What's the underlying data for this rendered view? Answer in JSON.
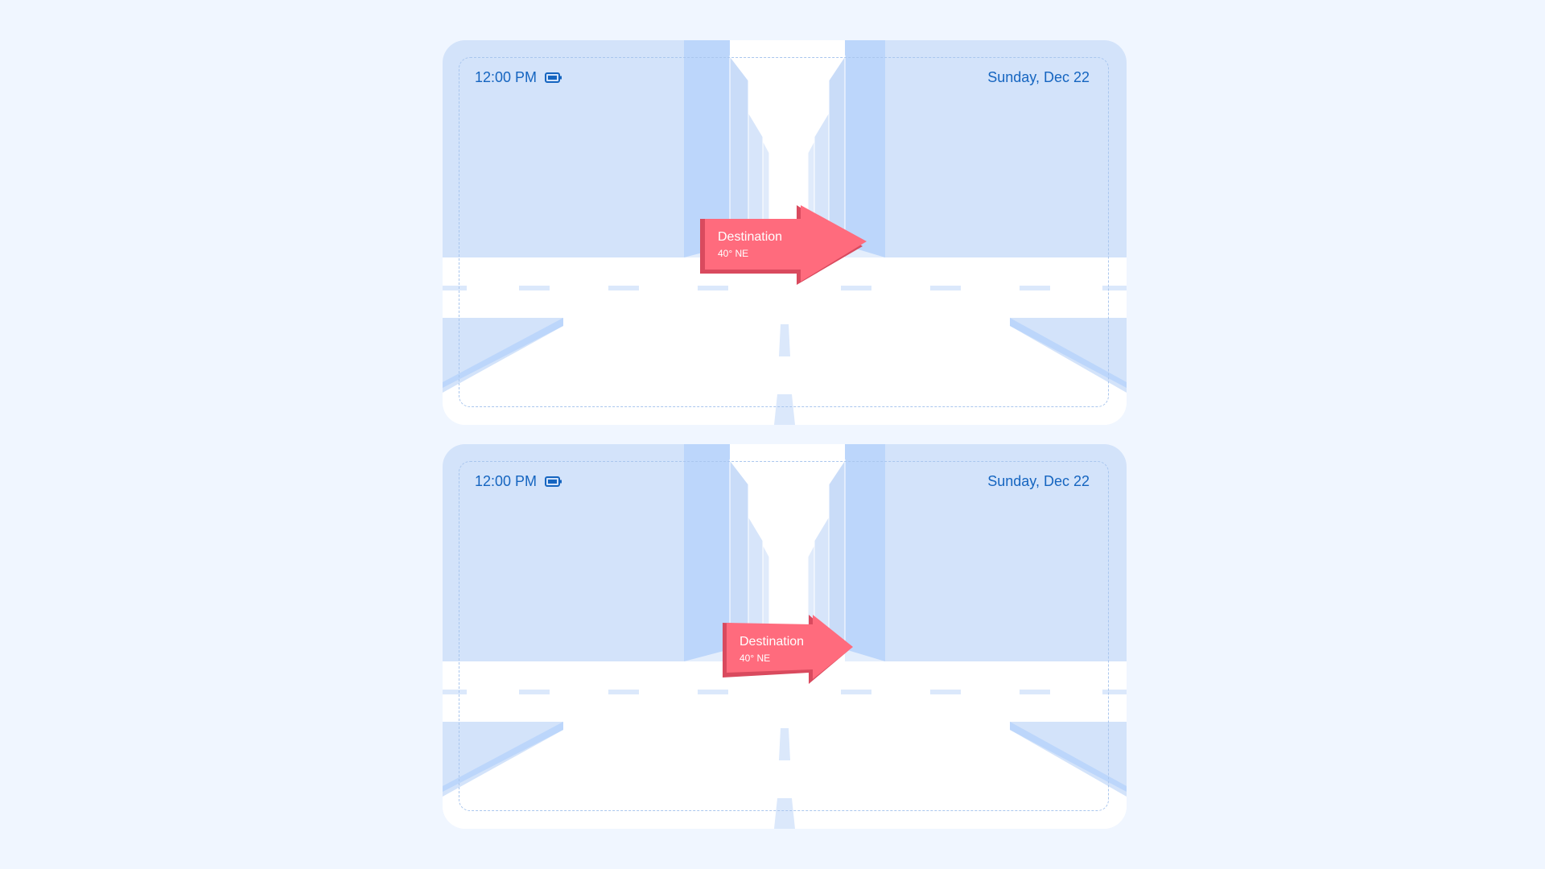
{
  "colors": {
    "background": "#f0f6ff",
    "accent": "#1565c0",
    "building_light": "#d3e3fa",
    "building_mid": "#bcd6fb",
    "sign": "#ff6b7d",
    "sign_dark": "#d94a5e"
  },
  "panels": [
    {
      "time": "12:00 PM",
      "battery_icon": "battery-icon",
      "date": "Sunday, Dec 22",
      "sign": {
        "title": "Destination",
        "subtitle": "40° NE",
        "style": "flat-arrow"
      }
    },
    {
      "time": "12:00 PM",
      "battery_icon": "battery-icon",
      "date": "Sunday, Dec 22",
      "sign": {
        "title": "Destination",
        "subtitle": "40° NE",
        "style": "perspective-arrow"
      }
    }
  ]
}
